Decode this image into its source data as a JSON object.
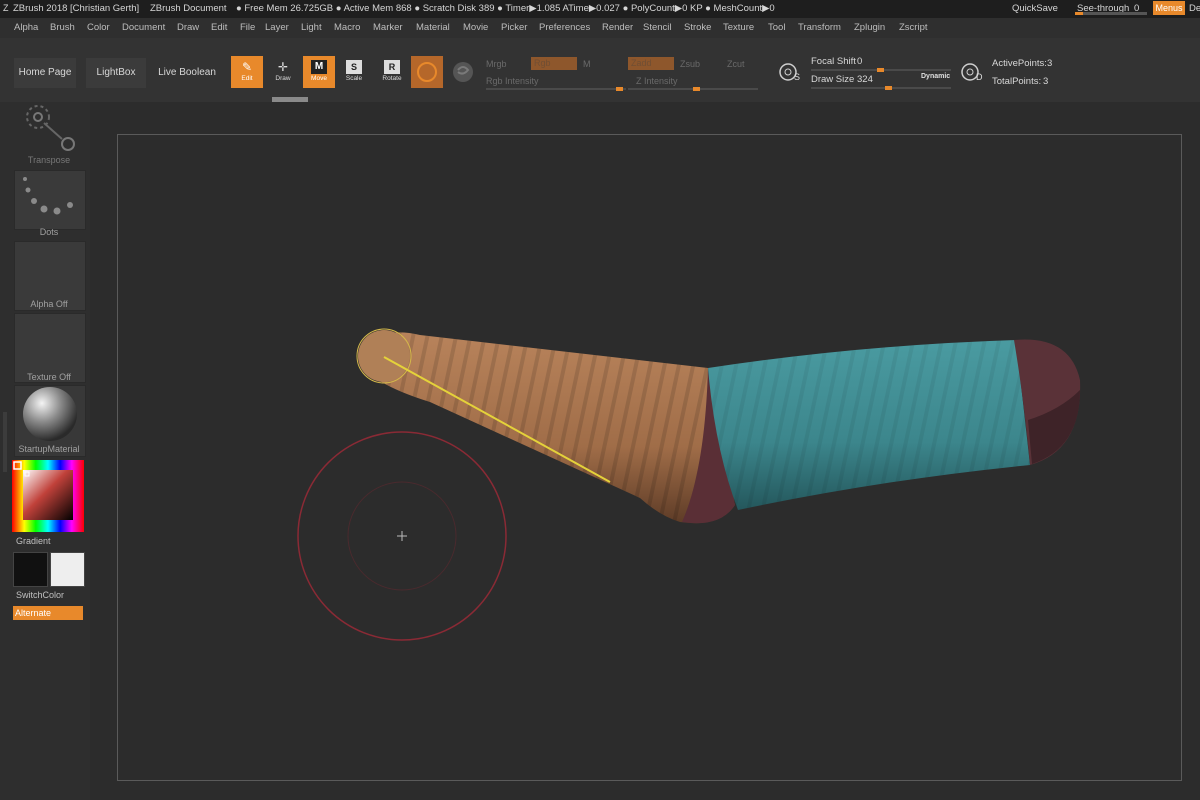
{
  "titlebar": {
    "app": "ZBrush 2018 [Christian Gerth]",
    "doc": "ZBrush Document",
    "stats": "● Free Mem 26.725GB ● Active Mem 868 ● Scratch Disk 389 ● Timer▶1.085 ATime▶0.027 ● PolyCount▶0 KP ● MeshCount▶0",
    "quicksave": "QuickSave",
    "see_through": "See-through",
    "see_through_value": "0",
    "menus": "Menus",
    "clipped": "De"
  },
  "menubar": [
    "Alpha",
    "Brush",
    "Color",
    "Document",
    "Draw",
    "Edit",
    "File",
    "Layer",
    "Light",
    "Macro",
    "Marker",
    "Material",
    "Movie",
    "Picker",
    "Preferences",
    "Render",
    "Stencil",
    "Stroke",
    "Texture",
    "Tool",
    "Transform",
    "Zplugin",
    "Zscript"
  ],
  "shelf": {
    "home_page": "Home Page",
    "lightbox": "LightBox",
    "live_boolean": "Live Boolean",
    "tools": [
      {
        "label": "Edit",
        "glyph": "✎",
        "active": true
      },
      {
        "label": "Draw",
        "glyph": "✛",
        "active": false
      },
      {
        "label": "Move",
        "glyph": "M",
        "active": true
      },
      {
        "label": "Scale",
        "glyph": "S",
        "active": false
      },
      {
        "label": "Rotate",
        "glyph": "R",
        "active": false
      }
    ],
    "mrgb": "Mrgb",
    "rgb": "Rgb",
    "m": "M",
    "rgb_intensity": "Rgb Intensity",
    "zadd": "Zadd",
    "zsub": "Zsub",
    "zcut": "Zcut",
    "z_intensity": "Z Intensity",
    "focal_shift_label": "Focal Shift",
    "focal_shift_value": "0",
    "draw_size_label": "Draw Size",
    "draw_size_value": "324",
    "dynamic": "Dynamic",
    "active_points_label": "ActivePoints:",
    "active_points_value": "3",
    "total_points_label": "TotalPoints:",
    "total_points_value": "3",
    "s_badge": "S",
    "d_badge": "D"
  },
  "lefttray": {
    "transpose": "Transpose",
    "dots": "Dots",
    "alpha_off": "Alpha Off",
    "texture_off": "Texture Off",
    "startup_material": "StartupMaterial",
    "gradient": "Gradient",
    "switchcolor": "SwitchColor",
    "alternate": "Alternate"
  },
  "colors": {
    "accent": "#e8892b",
    "skin": "#b07a53",
    "teal": "#3f8d93",
    "maroon": "#5a2f36",
    "transpose_line": "#e4d23a",
    "brush_ring": "#8a2a35"
  }
}
